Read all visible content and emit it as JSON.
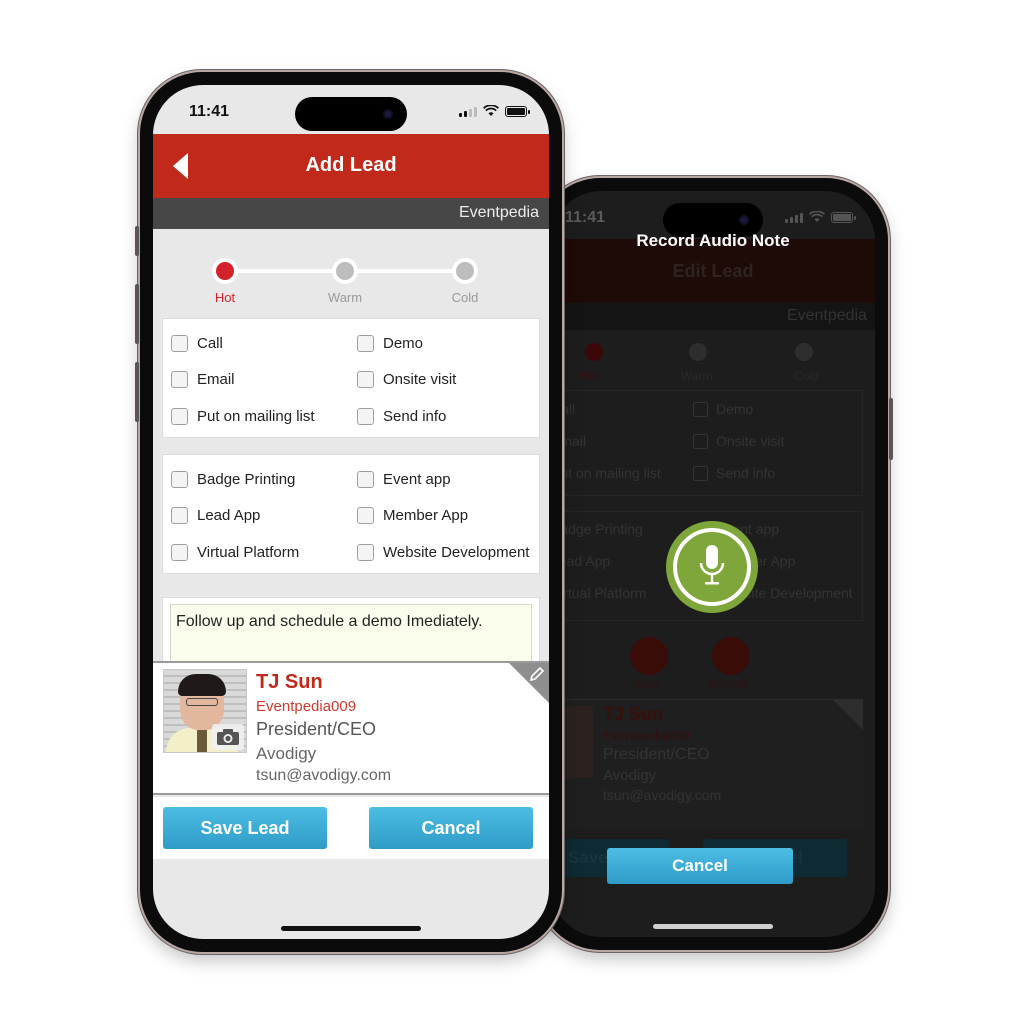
{
  "front_phone": {
    "status_bar": {
      "time": "11:41"
    },
    "header": {
      "title": "Add Lead",
      "back_icon": "chevron-left-icon"
    },
    "sub_bar": {
      "event_name": "Eventpedia"
    },
    "rating": {
      "options": [
        "Hot",
        "Warm",
        "Cold"
      ],
      "selected": "Hot"
    },
    "follow_up_options": [
      {
        "label": "Call",
        "checked": false
      },
      {
        "label": "Demo",
        "checked": false
      },
      {
        "label": "Email",
        "checked": false
      },
      {
        "label": "Onsite visit",
        "checked": false
      },
      {
        "label": "Put on mailing list",
        "checked": false
      },
      {
        "label": "Send info",
        "checked": false
      }
    ],
    "interest_options": [
      {
        "label": "Badge Printing",
        "checked": false
      },
      {
        "label": "Event app",
        "checked": false
      },
      {
        "label": "Lead App",
        "checked": false
      },
      {
        "label": "Member App",
        "checked": false
      },
      {
        "label": "Virtual Platform",
        "checked": false
      },
      {
        "label": "Website Development",
        "checked": false
      }
    ],
    "notes": {
      "value": "Follow up and schedule a demo Imediately."
    },
    "contact": {
      "name": "TJ Sun",
      "id": "Eventpedia009",
      "title": "President/CEO",
      "company": "Avodigy",
      "email": "tsun@avodigy.com",
      "photo_icon": "camera-icon",
      "edit_icon": "pencil-icon"
    },
    "buttons": {
      "save": "Save Lead",
      "cancel": "Cancel"
    }
  },
  "back_phone": {
    "status_bar": {
      "time": "11:41"
    },
    "overlay": {
      "title": "Record Audio Note",
      "mic_icon": "microphone-icon",
      "cancel": "Cancel"
    },
    "underlying": {
      "header_title": "Edit Lead",
      "event_name": "Eventpedia",
      "rating_options": [
        "Hot",
        "Warm",
        "Cold"
      ],
      "follow_up_options": [
        "Call",
        "Demo",
        "Email",
        "Onsite visit",
        "Put on mailing list",
        "Send info"
      ],
      "interest_options": [
        "Badge Printing",
        "Event app",
        "Lead App",
        "Member App",
        "Virtual Platform",
        "Website Development"
      ],
      "actions": [
        "Note",
        "Record"
      ],
      "contact": {
        "name": "TJ Sun",
        "id": "Eventpedia009",
        "title": "President/CEO",
        "company": "Avodigy",
        "email": "tsun@avodigy.com"
      },
      "buttons": [
        "Save Lead",
        "Cancel"
      ]
    }
  },
  "colors": {
    "header_red": "#c1291b",
    "hot_red": "#d3222a",
    "button_blue": "#3aaad6",
    "mic_green": "#7fa63a",
    "sub_bar_gray": "#474747"
  }
}
